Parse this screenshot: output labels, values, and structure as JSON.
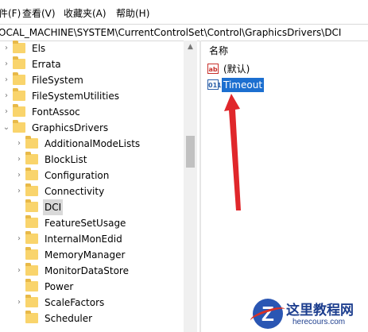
{
  "menu": [
    "件(F)",
    "查看(V)",
    "收藏夹(A)",
    "帮助(H)"
  ],
  "address": "OCAL_MACHINE\\SYSTEM\\CurrentControlSet\\Control\\GraphicsDrivers\\DCI",
  "tree": [
    {
      "label": "Els",
      "chevron": "›"
    },
    {
      "label": "Errata",
      "chevron": "›"
    },
    {
      "label": "FileSystem",
      "chevron": "›"
    },
    {
      "label": "FileSystemUtilities",
      "chevron": "›"
    },
    {
      "label": "FontAssoc",
      "chevron": "›"
    },
    {
      "label": "GraphicsDrivers",
      "chevron": "⌄"
    },
    {
      "label": "AdditionalModeLists",
      "chevron": "›"
    },
    {
      "label": "BlockList",
      "chevron": "›"
    },
    {
      "label": "Configuration",
      "chevron": "›"
    },
    {
      "label": "Connectivity",
      "chevron": "›"
    },
    {
      "label": "DCI",
      "chevron": ""
    },
    {
      "label": "FeatureSetUsage",
      "chevron": ""
    },
    {
      "label": "InternalMonEdid",
      "chevron": "›"
    },
    {
      "label": "MemoryManager",
      "chevron": ""
    },
    {
      "label": "MonitorDataStore",
      "chevron": "›"
    },
    {
      "label": "Power",
      "chevron": ""
    },
    {
      "label": "ScaleFactors",
      "chevron": "›"
    },
    {
      "label": "Scheduler",
      "chevron": ""
    }
  ],
  "right": {
    "column_header": "名称",
    "values": [
      {
        "icon": "ab",
        "name": "(默认)"
      },
      {
        "icon": "011",
        "name": "Timeout"
      }
    ]
  },
  "watermark": {
    "logo_letter": "Z",
    "title": "这里教程网",
    "url": "herecours.com"
  },
  "colors": {
    "selection": "#1c6fd0",
    "arrow": "#e0272b",
    "folder": "#f9d46c"
  }
}
